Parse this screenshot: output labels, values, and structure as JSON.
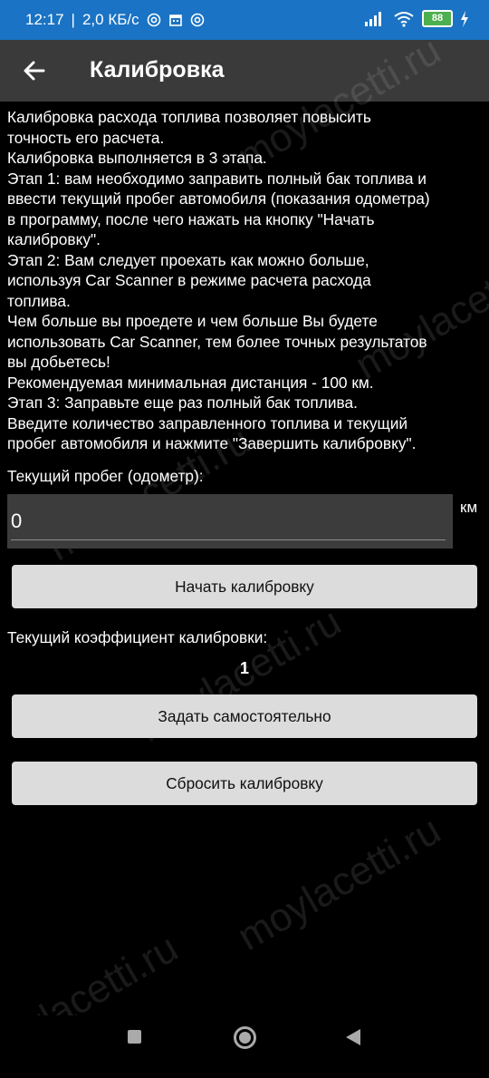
{
  "status_bar": {
    "time": "12:17",
    "speed": "2,0 КБ/с",
    "battery": "88"
  },
  "app_bar": {
    "title": "Калибровка"
  },
  "description": "Калибровка расхода топлива позволяет повысить\nточность его расчета.\nКалибровка выполняется в 3 этапа.\nЭтап 1: вам необходимо заправить полный бак топлива и\nввести текущий пробег автомобиля (показания одометра)\nв программу, после чего нажать на кнопку \"Начать\nкалибровку\".\nЭтап 2: Вам следует проехать как можно больше,\nиспользуя Car Scanner в режиме расчета расхода\nтоплива.\nЧем больше вы проедете и чем больше Вы будете\nиспользовать Car Scanner, тем более точных результатов\nвы добьетесь!\nРекомендуемая минимальная дистанция - 100 км.\nЭтап 3: Заправьте еще раз полный бак топлива.\nВведите количество заправленного топлива и текущий\nпробег автомобиля и нажмите \"Завершить калибровку\".",
  "odometer": {
    "label": "Текущий пробег (одометр):",
    "value": "0",
    "unit": "км"
  },
  "buttons": {
    "start": "Начать калибровку",
    "set_manually": "Задать самостоятельно",
    "reset": "Сбросить калибровку"
  },
  "coefficient": {
    "label": "Текущий коэффициент калибровки:",
    "value": "1"
  },
  "watermark": "moylacetti.ru",
  "colors": {
    "status_bar": "#1a73c4",
    "app_bar": "#3a3a3a",
    "button": "#dcdcdc",
    "input_bg": "#3c3c3c"
  }
}
